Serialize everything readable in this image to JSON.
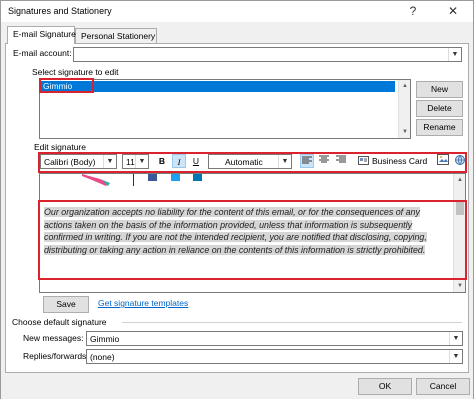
{
  "window": {
    "title": "Signatures and Stationery",
    "help_label": "?",
    "close_label": "✕"
  },
  "tabs": [
    {
      "label": "E-mail Signature",
      "active": true
    },
    {
      "label": "Personal Stationery",
      "active": false
    }
  ],
  "email_account": {
    "label": "E-mail account:",
    "value": ""
  },
  "select_signature": {
    "label": "Select signature to edit",
    "items": [
      "Gimmio"
    ],
    "selected": "Gimmio"
  },
  "side_buttons": {
    "new": "New",
    "delete": "Delete",
    "rename": "Rename"
  },
  "edit_signature": {
    "label": "Edit signature",
    "font": "Calibri (Body)",
    "size": "11",
    "bold": "B",
    "italic": "I",
    "underline": "U",
    "color": "Automatic",
    "business_card": "Business Card",
    "disclaimer": "Our organization accepts no liability for the content of this email, or for the consequences of any actions taken on the basis of the information provided, unless that information is subsequently confirmed in writing. If you are not the intended recipient, you are notified that disclosing, copying, distributing or taking any action in reliance on the contents of this information is strictly prohibited."
  },
  "actions": {
    "save": "Save",
    "templates_link": "Get signature templates"
  },
  "default_signature": {
    "label": "Choose default signature",
    "new_messages_label": "New messages:",
    "new_messages_value": "Gimmio",
    "replies_label": "Replies/forwards:",
    "replies_value": "(none)"
  },
  "footer": {
    "ok": "OK",
    "cancel": "Cancel"
  },
  "colors": {
    "highlight": "#d9232e",
    "selection": "#0078d7",
    "link": "#0066cc"
  }
}
